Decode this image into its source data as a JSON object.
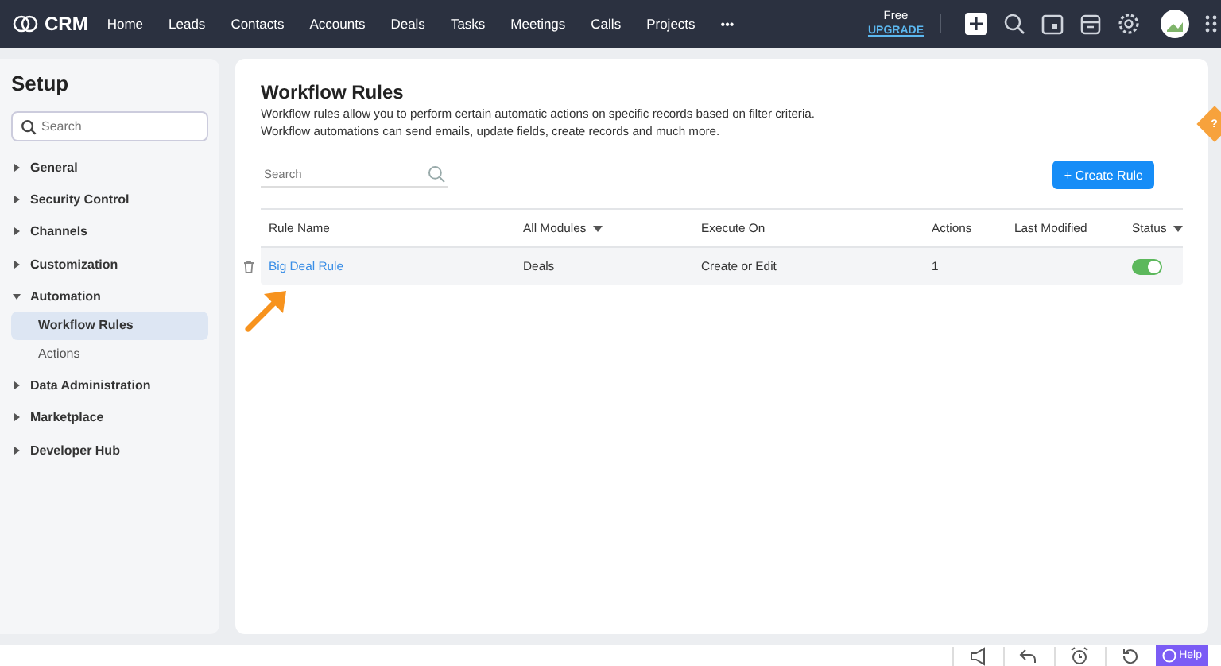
{
  "topbar": {
    "logo": "CRM",
    "nav": [
      {
        "label": "Home",
        "selected": false
      },
      {
        "label": "Leads",
        "selected": false
      },
      {
        "label": "Contacts",
        "selected": false
      },
      {
        "label": "Accounts",
        "selected": false
      },
      {
        "label": "Deals",
        "selected": false
      },
      {
        "label": "Tasks",
        "selected": false
      },
      {
        "label": "Meetings",
        "selected": false
      },
      {
        "label": "Calls",
        "selected": false
      },
      {
        "label": "Projects",
        "selected": false
      }
    ],
    "more": "•••",
    "plan": "Free",
    "upgrade": "UPGRADE"
  },
  "sidebar": {
    "title": "Setup",
    "search_placeholder": "Search",
    "items": [
      {
        "label": "General",
        "expanded": false
      },
      {
        "label": "Security Control",
        "expanded": false
      },
      {
        "label": "Channels",
        "expanded": false
      },
      {
        "label": "Customization",
        "expanded": false
      },
      {
        "label": "Automation",
        "expanded": true,
        "children": [
          {
            "label": "Workflow Rules",
            "selected": true
          },
          {
            "label": "Actions",
            "selected": false
          }
        ]
      },
      {
        "label": "Data Administration",
        "expanded": false
      },
      {
        "label": "Marketplace",
        "expanded": false
      },
      {
        "label": "Developer Hub",
        "expanded": false
      }
    ]
  },
  "main": {
    "title": "Workflow Rules",
    "description": [
      "Workflow rules allow you to perform certain automatic actions on specific records based on filter criteria.",
      "Workflow automations can send emails, update fields, create records and much more."
    ],
    "search_placeholder": "Search",
    "create_button": "+ Create Rule",
    "table": {
      "columns": [
        {
          "label": "Rule Name",
          "dropdown": false
        },
        {
          "label": "All Modules",
          "dropdown": true
        },
        {
          "label": "Execute On",
          "dropdown": false
        },
        {
          "label": "Actions",
          "dropdown": false
        },
        {
          "label": "Last Modified",
          "dropdown": false
        },
        {
          "label": "Status",
          "dropdown": true
        }
      ],
      "rows": [
        {
          "name": "Big Deal Rule",
          "module": "Deals",
          "execute_on": "Create or Edit",
          "actions": "1",
          "enabled": true
        }
      ]
    }
  },
  "help_tab": "?",
  "footer": {
    "help": "Help"
  }
}
